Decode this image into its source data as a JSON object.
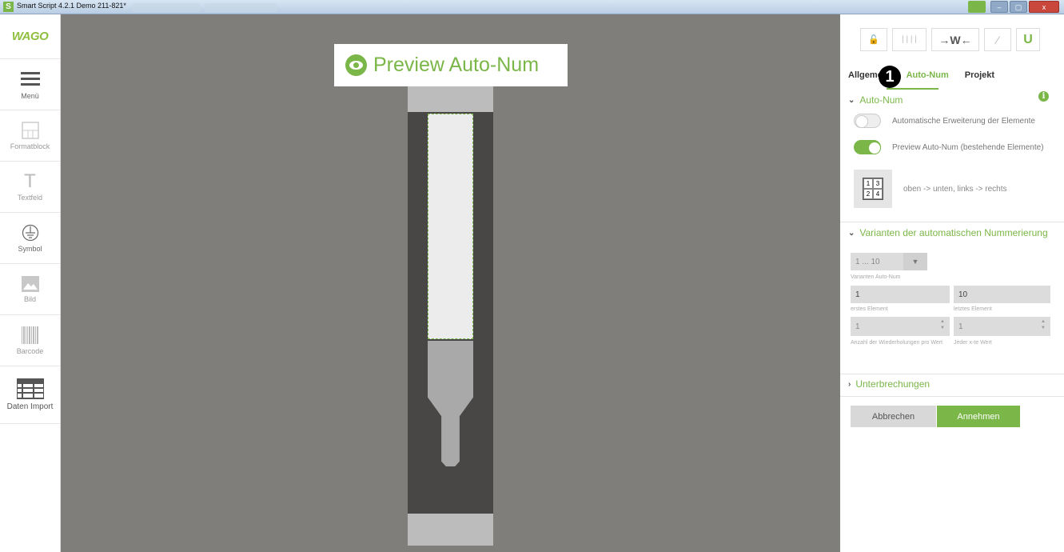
{
  "window": {
    "title": "Smart Script 4.2.1  Demo 211-821*",
    "icon": "S",
    "buttons": {
      "minimize": "–",
      "maximize": "▢",
      "close": "x"
    }
  },
  "sidebar": {
    "logo": "WAGO",
    "items": [
      {
        "label": "Menü",
        "icon": "menu-icon"
      },
      {
        "label": "Formatblock",
        "icon": "format-block-icon"
      },
      {
        "label": "Textfeld",
        "icon": "text-icon",
        "glyph": "T"
      },
      {
        "label": "Symbol",
        "icon": "ground-symbol-icon"
      },
      {
        "label": "Bild",
        "icon": "image-icon"
      },
      {
        "label": "Barcode",
        "icon": "barcode-icon"
      },
      {
        "label": "Daten Import",
        "icon": "table-icon"
      }
    ]
  },
  "canvas": {
    "preview_label": "Preview Auto-Num"
  },
  "panel": {
    "toolbar": {
      "lock": "🔓",
      "columns": "| | | |",
      "fit": "→W←",
      "wand": "⁄",
      "magnet": "U"
    },
    "tabs": [
      {
        "label": "Allgemein"
      },
      {
        "label": "Auto-Num"
      },
      {
        "label": "Projekt"
      }
    ],
    "callout": "1",
    "autonum": {
      "heading": "Auto-Num",
      "info": "i",
      "toggle_extend_label": "Automatische Erweiterung der Elemente",
      "toggle_extend_on": false,
      "toggle_preview_label": "Preview Auto-Num (bestehende Elemente)",
      "toggle_preview_on": true,
      "order_grid": [
        "1",
        "3",
        "2",
        "4"
      ],
      "order_label": "oben -> unten, links -> rechts"
    },
    "variants": {
      "heading": "Varianten der automatischen Nummerierung",
      "dropdown_value": "1 ... 10",
      "dropdown_arrow": "▼",
      "dropdown_caption": "Varianten Auto-Num",
      "first_value": "1",
      "first_caption": "erstes Element",
      "last_value": "10",
      "last_caption": "letztes Element",
      "repeat_value": "1",
      "repeat_caption": "Anzahl der Wiederholungen pro Wert",
      "nth_value": "1",
      "nth_caption": "Jeder x-te Wert"
    },
    "breaks": {
      "heading": "Unterbrechungen"
    },
    "buttons": {
      "cancel": "Abbrechen",
      "accept": "Annehmen"
    }
  },
  "colors": {
    "accent": "#7ab648",
    "canvas_bg": "#7f7e7a",
    "rail": "#484745"
  }
}
